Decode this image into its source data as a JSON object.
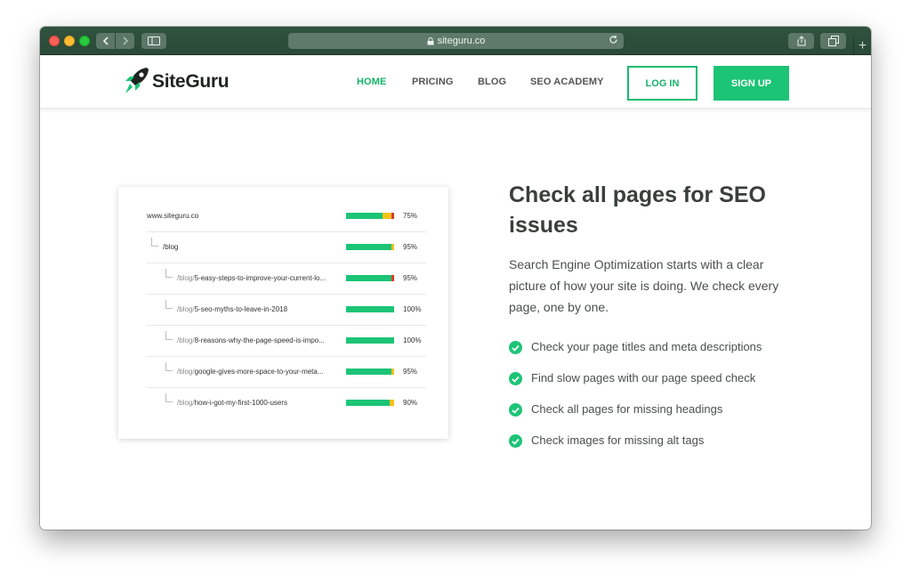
{
  "browser": {
    "url": "siteguru.co",
    "plus_label": "+"
  },
  "header": {
    "logo_text": "SiteGuru",
    "nav": {
      "home": "HOME",
      "pricing": "PRICING",
      "blog": "BLOG",
      "academy": "SEO ACADEMY"
    },
    "login_label": "LOG IN",
    "signup_label": "SIGN UP"
  },
  "pages": [
    {
      "prefix": "",
      "path": "www.siteguru.co",
      "percent": "75%",
      "green": 0.75,
      "yellow": 0.2,
      "red": 0.05,
      "level": 0
    },
    {
      "prefix": "",
      "path": "/blog",
      "percent": "95%",
      "green": 0.95,
      "yellow": 0.05,
      "red": 0,
      "level": 1
    },
    {
      "prefix": "/blog/",
      "path": "5-easy-steps-to-improve-your-current-lo...",
      "percent": "95%",
      "green": 0.95,
      "yellow": 0,
      "red": 0.05,
      "level": 2
    },
    {
      "prefix": "/blog/",
      "path": "5-seo-myths-to-leave-in-2018",
      "percent": "100%",
      "green": 1.0,
      "yellow": 0,
      "red": 0,
      "level": 2
    },
    {
      "prefix": "/blog/",
      "path": "8-reasons-why-the-page-speed-is-impo...",
      "percent": "100%",
      "green": 1.0,
      "yellow": 0,
      "red": 0,
      "level": 2
    },
    {
      "prefix": "/blog/",
      "path": "google-gives-more-space-to-your-meta...",
      "percent": "95%",
      "green": 0.95,
      "yellow": 0.05,
      "red": 0,
      "level": 2
    },
    {
      "prefix": "/blog/",
      "path": "how-i-got-my-first-1000-users",
      "percent": "90%",
      "green": 0.9,
      "yellow": 0.1,
      "red": 0,
      "level": 2
    }
  ],
  "content": {
    "headline": "Check all pages for SEO issues",
    "lead": "Search Engine Optimization starts with a clear picture of how your site is doing. We check every page, one by one.",
    "features": [
      "Check your page titles and meta descriptions",
      "Find slow pages with our page speed check",
      "Check all pages for missing headings",
      "Check images for missing alt tags"
    ]
  },
  "colors": {
    "brand_green": "#1cc476",
    "warning_yellow": "#f5c21a",
    "error_red": "#d93a2b",
    "titlebar": "#2d4e3a"
  }
}
